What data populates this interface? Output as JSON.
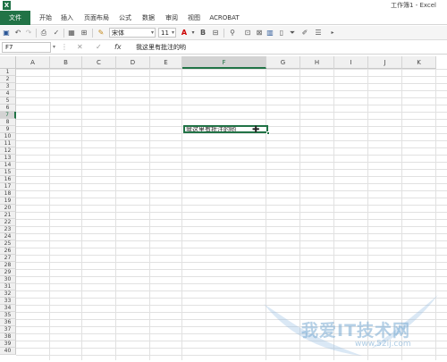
{
  "window": {
    "title": "工作簿1 - Excel",
    "app_icon_letter": "X"
  },
  "ribbon": {
    "tabs": [
      {
        "id": "file",
        "label": "文件"
      },
      {
        "id": "home",
        "label": "开始"
      },
      {
        "id": "insert",
        "label": "插入"
      },
      {
        "id": "layout",
        "label": "页面布局"
      },
      {
        "id": "formulas",
        "label": "公式"
      },
      {
        "id": "data",
        "label": "数据"
      },
      {
        "id": "review",
        "label": "审阅"
      },
      {
        "id": "view",
        "label": "视图"
      },
      {
        "id": "acrobat",
        "label": "ACROBAT"
      }
    ]
  },
  "toolbar": {
    "font_name": "宋体",
    "font_size": "11",
    "bold_label": "B"
  },
  "formula_bar": {
    "name_box": "F7",
    "fx_label": "fx",
    "content": "我这里有批注的哟"
  },
  "sheet": {
    "columns": [
      "A",
      "B",
      "C",
      "D",
      "E",
      "F",
      "G",
      "H",
      "I",
      "J",
      "K"
    ],
    "active_column": "F",
    "active_row": 7,
    "row_count": 40,
    "active_cell_value": "我这里有批注的哟"
  },
  "watermark": {
    "text": "我爱IT技术网",
    "url": "www.52ij.com"
  }
}
